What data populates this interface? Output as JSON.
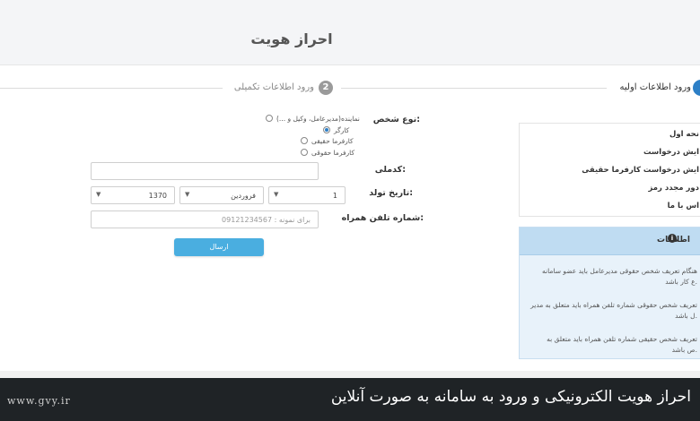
{
  "header": {
    "title": "احراز هویت"
  },
  "steps": [
    {
      "number": "1",
      "label": "ورود اطلاعات اولیه",
      "active": true
    },
    {
      "number": "2",
      "label": "ورود اطلاعات تکمیلی",
      "active": false
    }
  ],
  "form": {
    "person_type_label": "نوع شخص:",
    "person_types": [
      {
        "label": "نماینده(مدیرعامل، وکیل و ...)",
        "checked": false
      },
      {
        "label": "کارگر",
        "checked": true
      },
      {
        "label": "کارفرما حقیقی",
        "checked": false
      },
      {
        "label": "کارفرما حقوقی",
        "checked": false
      }
    ],
    "national_code_label": "کدملی:",
    "national_code_value": "",
    "birth_date_label": "تاریخ تولد:",
    "birth_day": "1",
    "birth_month": "فروردین",
    "birth_year": "1370",
    "phone_label": "شماره تلفن همراه:",
    "phone_placeholder": "برای نمونه : 09121234567",
    "submit_label": "ارسال"
  },
  "sidemenu": {
    "items": [
      {
        "label": "نحه اول"
      },
      {
        "label": "ایش درخواست"
      },
      {
        "label": "ایش درخواست کارفرما حقیقی"
      },
      {
        "label": "دور مجدد رمز"
      },
      {
        "label": "اس با ما"
      }
    ]
  },
  "info": {
    "title": "اطلاعات",
    "icon": "info-icon",
    "paragraphs": [
      {
        "line1": "هنگام تعریف شخص حقوقی مدیرعامل باید عضو سامانه",
        "line2": "ع کار باشد."
      },
      {
        "line1": "تعریف شخص حقوقی شماره تلفن همراه باید متعلق به مدیر",
        "line2": "ل باشد."
      },
      {
        "line1": "تعریف شخص حقیقی شماره تلفن همراه باید متعلق به",
        "line2": "ص باشد."
      }
    ]
  },
  "caption": {
    "text": "احراز هویت الکترونیکی و ورود به سامانه به صورت آنلاین",
    "watermark": "www.gvy.ir"
  }
}
